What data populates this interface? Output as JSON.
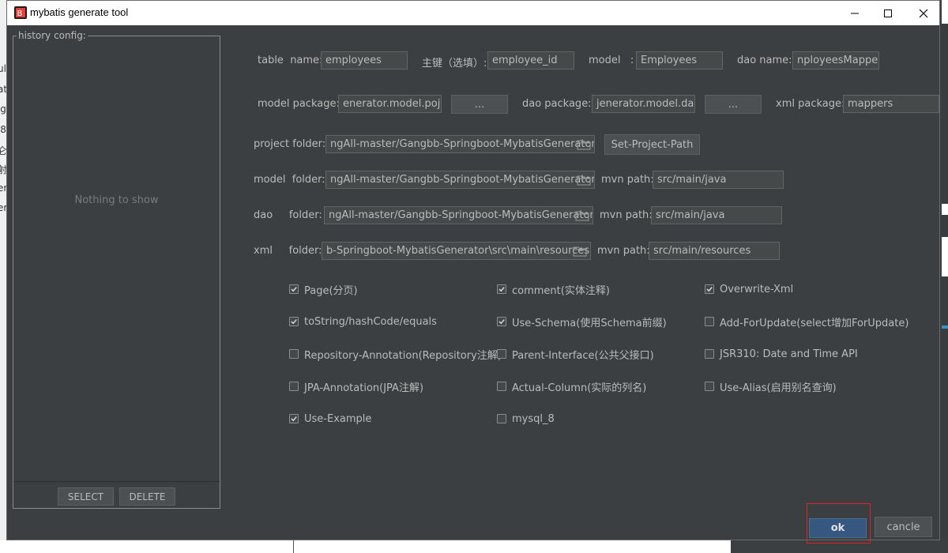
{
  "window": {
    "title": "mybatis generate tool"
  },
  "history": {
    "legend": "history config:",
    "empty_message": "Nothing to show",
    "select_label": "SELECT",
    "delete_label": "DELETE"
  },
  "form": {
    "table_name_label": "table  name:",
    "table_name_value": "employees",
    "primary_key_label": "主键（选填）:",
    "primary_key_value": "employee_id",
    "model_label": "model   :",
    "model_value": "Employees",
    "dao_name_label": "dao name:",
    "dao_name_value": "nployeesMapper",
    "model_package_label": "model package:",
    "model_package_value": "enerator.model.pojo",
    "dao_package_label": "dao package:",
    "dao_package_value": "jenerator.model.dao",
    "xml_package_label": "xml package:",
    "xml_package_value": "mappers",
    "browse_label": "...",
    "project_folder_label": "project folder:",
    "project_folder_value": "ngAll-master/Gangbb-Springboot-MybatisGenerator",
    "set_project_path_label": "Set-Project-Path",
    "model_folder_label": "model  folder:",
    "model_folder_value": "ngAll-master/Gangbb-Springboot-MybatisGenerator",
    "model_mvn_label": "mvn path:",
    "model_mvn_value": "src/main/java",
    "dao_folder_label": "dao     folder:",
    "dao_folder_value": "ngAll-master/Gangbb-Springboot-MybatisGenerator",
    "dao_mvn_label": "mvn path:",
    "dao_mvn_value": "src/main/java",
    "xml_folder_label": "xml     folder:",
    "xml_folder_value": "b-Springboot-MybatisGenerator\\src\\main\\resources",
    "xml_mvn_label": "mvn path:",
    "xml_mvn_value": "src/main/resources"
  },
  "options": [
    {
      "label": "Page(分页)",
      "checked": true
    },
    {
      "label": "comment(实体注释)",
      "checked": true
    },
    {
      "label": "Overwrite-Xml",
      "checked": true
    },
    {
      "label": "toString/hashCode/equals",
      "checked": true
    },
    {
      "label": "Use-Schema(使用Schema前缀)",
      "checked": true
    },
    {
      "label": "Add-ForUpdate(select增加ForUpdate)",
      "checked": false
    },
    {
      "label": "Repository-Annotation(Repository注解)",
      "checked": false
    },
    {
      "label": "Parent-Interface(公共父接口)",
      "checked": false
    },
    {
      "label": "JSR310: Date and Time API",
      "checked": false
    },
    {
      "label": "JPA-Annotation(JPA注解)",
      "checked": false
    },
    {
      "label": "Actual-Column(实际的列名)",
      "checked": false
    },
    {
      "label": "Use-Alias(启用别名查询)",
      "checked": false
    },
    {
      "label": "Use-Example",
      "checked": true
    },
    {
      "label": "mysql_8",
      "checked": false
    }
  ],
  "buttons": {
    "ok_label": "ok",
    "cancel_label": "cancle"
  },
  "colors": {
    "accent": "#365880",
    "highlight_outline": "#e0202a",
    "background": "#3c3f41"
  }
}
